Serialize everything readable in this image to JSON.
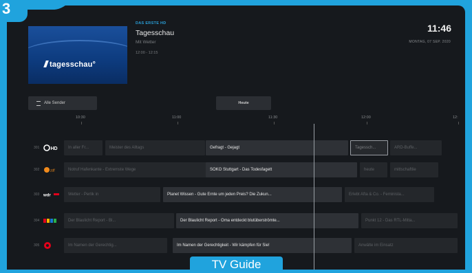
{
  "step_number": "3",
  "caption": "TV Guide",
  "current": {
    "channel": "DAS ERSTE HD",
    "title": "Tagesschau",
    "subtitle": "Mit Wetter",
    "time": "12:00 - 12:15",
    "thumbnail_logo": "tagesschau°"
  },
  "clock": {
    "time": "11:46",
    "date": "MONTAG, 07 SEP. 2020"
  },
  "buttons": {
    "filter": "Alle Sender",
    "today": "Heute"
  },
  "timeline": [
    "10:30",
    "11:00",
    "11:30",
    "12:00",
    "12:"
  ],
  "rows": [
    {
      "number": "301",
      "logo": "ORF HD",
      "cells": [
        {
          "text": "In aller Fr...",
          "style": "dim"
        },
        {
          "text": "Meister des Alltags",
          "style": "dim"
        },
        {
          "text": "Gefragt - Gejagt",
          "style": "bright"
        },
        {
          "text": "Tagessch...",
          "style": "focus"
        },
        {
          "text": "ARD-Buffe...",
          "style": "dim"
        }
      ]
    },
    {
      "number": "302",
      "logo": "ZDF HD",
      "cells": [
        {
          "text": "Notruf Hafenkante - Extremste Wege",
          "style": "dim"
        },
        {
          "text": "SOKO Stuttgart - Das Todesfagett",
          "style": "bright"
        },
        {
          "text": "heute",
          "style": "dim"
        },
        {
          "text": "mittschaftlie",
          "style": "dim"
        }
      ]
    },
    {
      "number": "303",
      "logo": "WDR",
      "cells": [
        {
          "text": "Wetter - Perlik in",
          "style": "dim"
        },
        {
          "text": "Planet Wissen - Gute Ernte um jeden Preis? Die Zukun...",
          "style": "bright"
        },
        {
          "text": "Erlebt Afta & Co. - Feminista...",
          "style": "dim"
        }
      ]
    },
    {
      "number": "304",
      "logo": "NDR",
      "cells": [
        {
          "text": "Der Blaulicht Report - Bl...",
          "style": "dim"
        },
        {
          "text": "Der Blaulicht Report - Oma entdeckt blutüberströmte...",
          "style": "bright"
        },
        {
          "text": "Punkt 12 - Das RTL-Mitta...",
          "style": "dim"
        }
      ]
    },
    {
      "number": "305",
      "logo": "SAT1",
      "cells": [
        {
          "text": "Im Namen der Gerechtig...",
          "style": "dim"
        },
        {
          "text": "Im Namen der Gerechtigkeit - Wir kämpfen für Sie!",
          "style": "bright"
        },
        {
          "text": "Anwälte im Einsatz",
          "style": "dim"
        }
      ]
    }
  ],
  "colors": {
    "frame": "#20a3dd",
    "screen": "#16191d",
    "cell": "#24272b"
  }
}
